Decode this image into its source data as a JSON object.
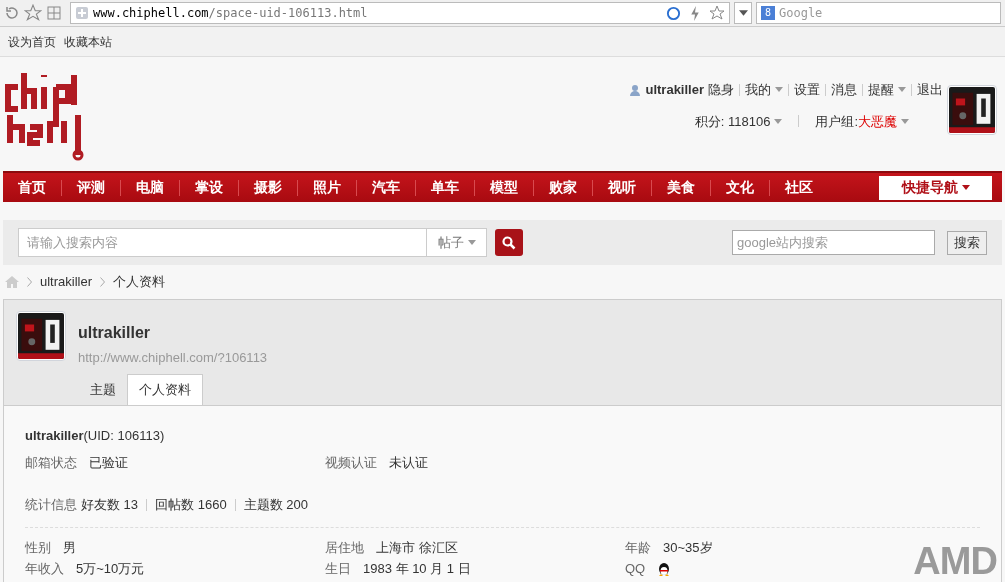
{
  "browser": {
    "url_host": "www.chiphell.com",
    "url_path": "/space-uid-106113.html",
    "search_placeholder": "Google",
    "search_engine_letter": "8"
  },
  "topbar": {
    "links": [
      "设为首页",
      "收藏本站"
    ]
  },
  "header": {
    "username": "ultrakiller",
    "user_links": [
      {
        "label": "隐身",
        "dropdown": false
      },
      {
        "label": "我的",
        "dropdown": true
      },
      {
        "label": "设置",
        "dropdown": false
      },
      {
        "label": "消息",
        "dropdown": false
      },
      {
        "label": "提醒",
        "dropdown": true
      },
      {
        "label": "退出",
        "dropdown": false
      }
    ],
    "points_label": "积分: 118106",
    "group_label": "用户组: ",
    "group_value": "大恶魔"
  },
  "nav": {
    "items": [
      "首页",
      "评测",
      "电脑",
      "掌设",
      "摄影",
      "照片",
      "汽车",
      "单车",
      "模型",
      "败家",
      "视听",
      "美食",
      "文化",
      "社区"
    ],
    "quick_nav": "快捷导航"
  },
  "search": {
    "placeholder": "请输入搜索内容",
    "scope": "帖子",
    "google_placeholder": "google站内搜索",
    "google_button": "搜索"
  },
  "breadcrumb": [
    "ultrakiller",
    "个人资料"
  ],
  "profile": {
    "name": "ultrakiller",
    "url": "http://www.chiphell.com/?106113",
    "tabs": [
      {
        "label": "主题",
        "selected": false
      },
      {
        "label": "个人资料",
        "selected": true
      }
    ]
  },
  "details": {
    "name": "ultrakiller",
    "uid": "(UID: 106113)",
    "verify": [
      {
        "label": "邮箱状态",
        "value": "已验证"
      },
      {
        "label": "视频认证",
        "value": "未认证"
      }
    ],
    "stats_label": "统计信息",
    "stats": [
      "好友数 13",
      "回帖数 1660",
      "主题数 200"
    ],
    "fields": [
      {
        "label": "性别",
        "value": "男",
        "kind": "text"
      },
      {
        "label": "居住地",
        "value": "上海市 徐汇区",
        "kind": "text"
      },
      {
        "label": "年龄",
        "value": "30~35岁",
        "kind": "text"
      },
      {
        "label": "年收入",
        "value": "5万~10万元",
        "kind": "text"
      },
      {
        "label": "生日",
        "value": "1983 年 10 月 1 日",
        "kind": "text"
      },
      {
        "label": "QQ",
        "kind": "qq"
      }
    ]
  },
  "sponsor": {
    "logo_text": "AMD"
  }
}
